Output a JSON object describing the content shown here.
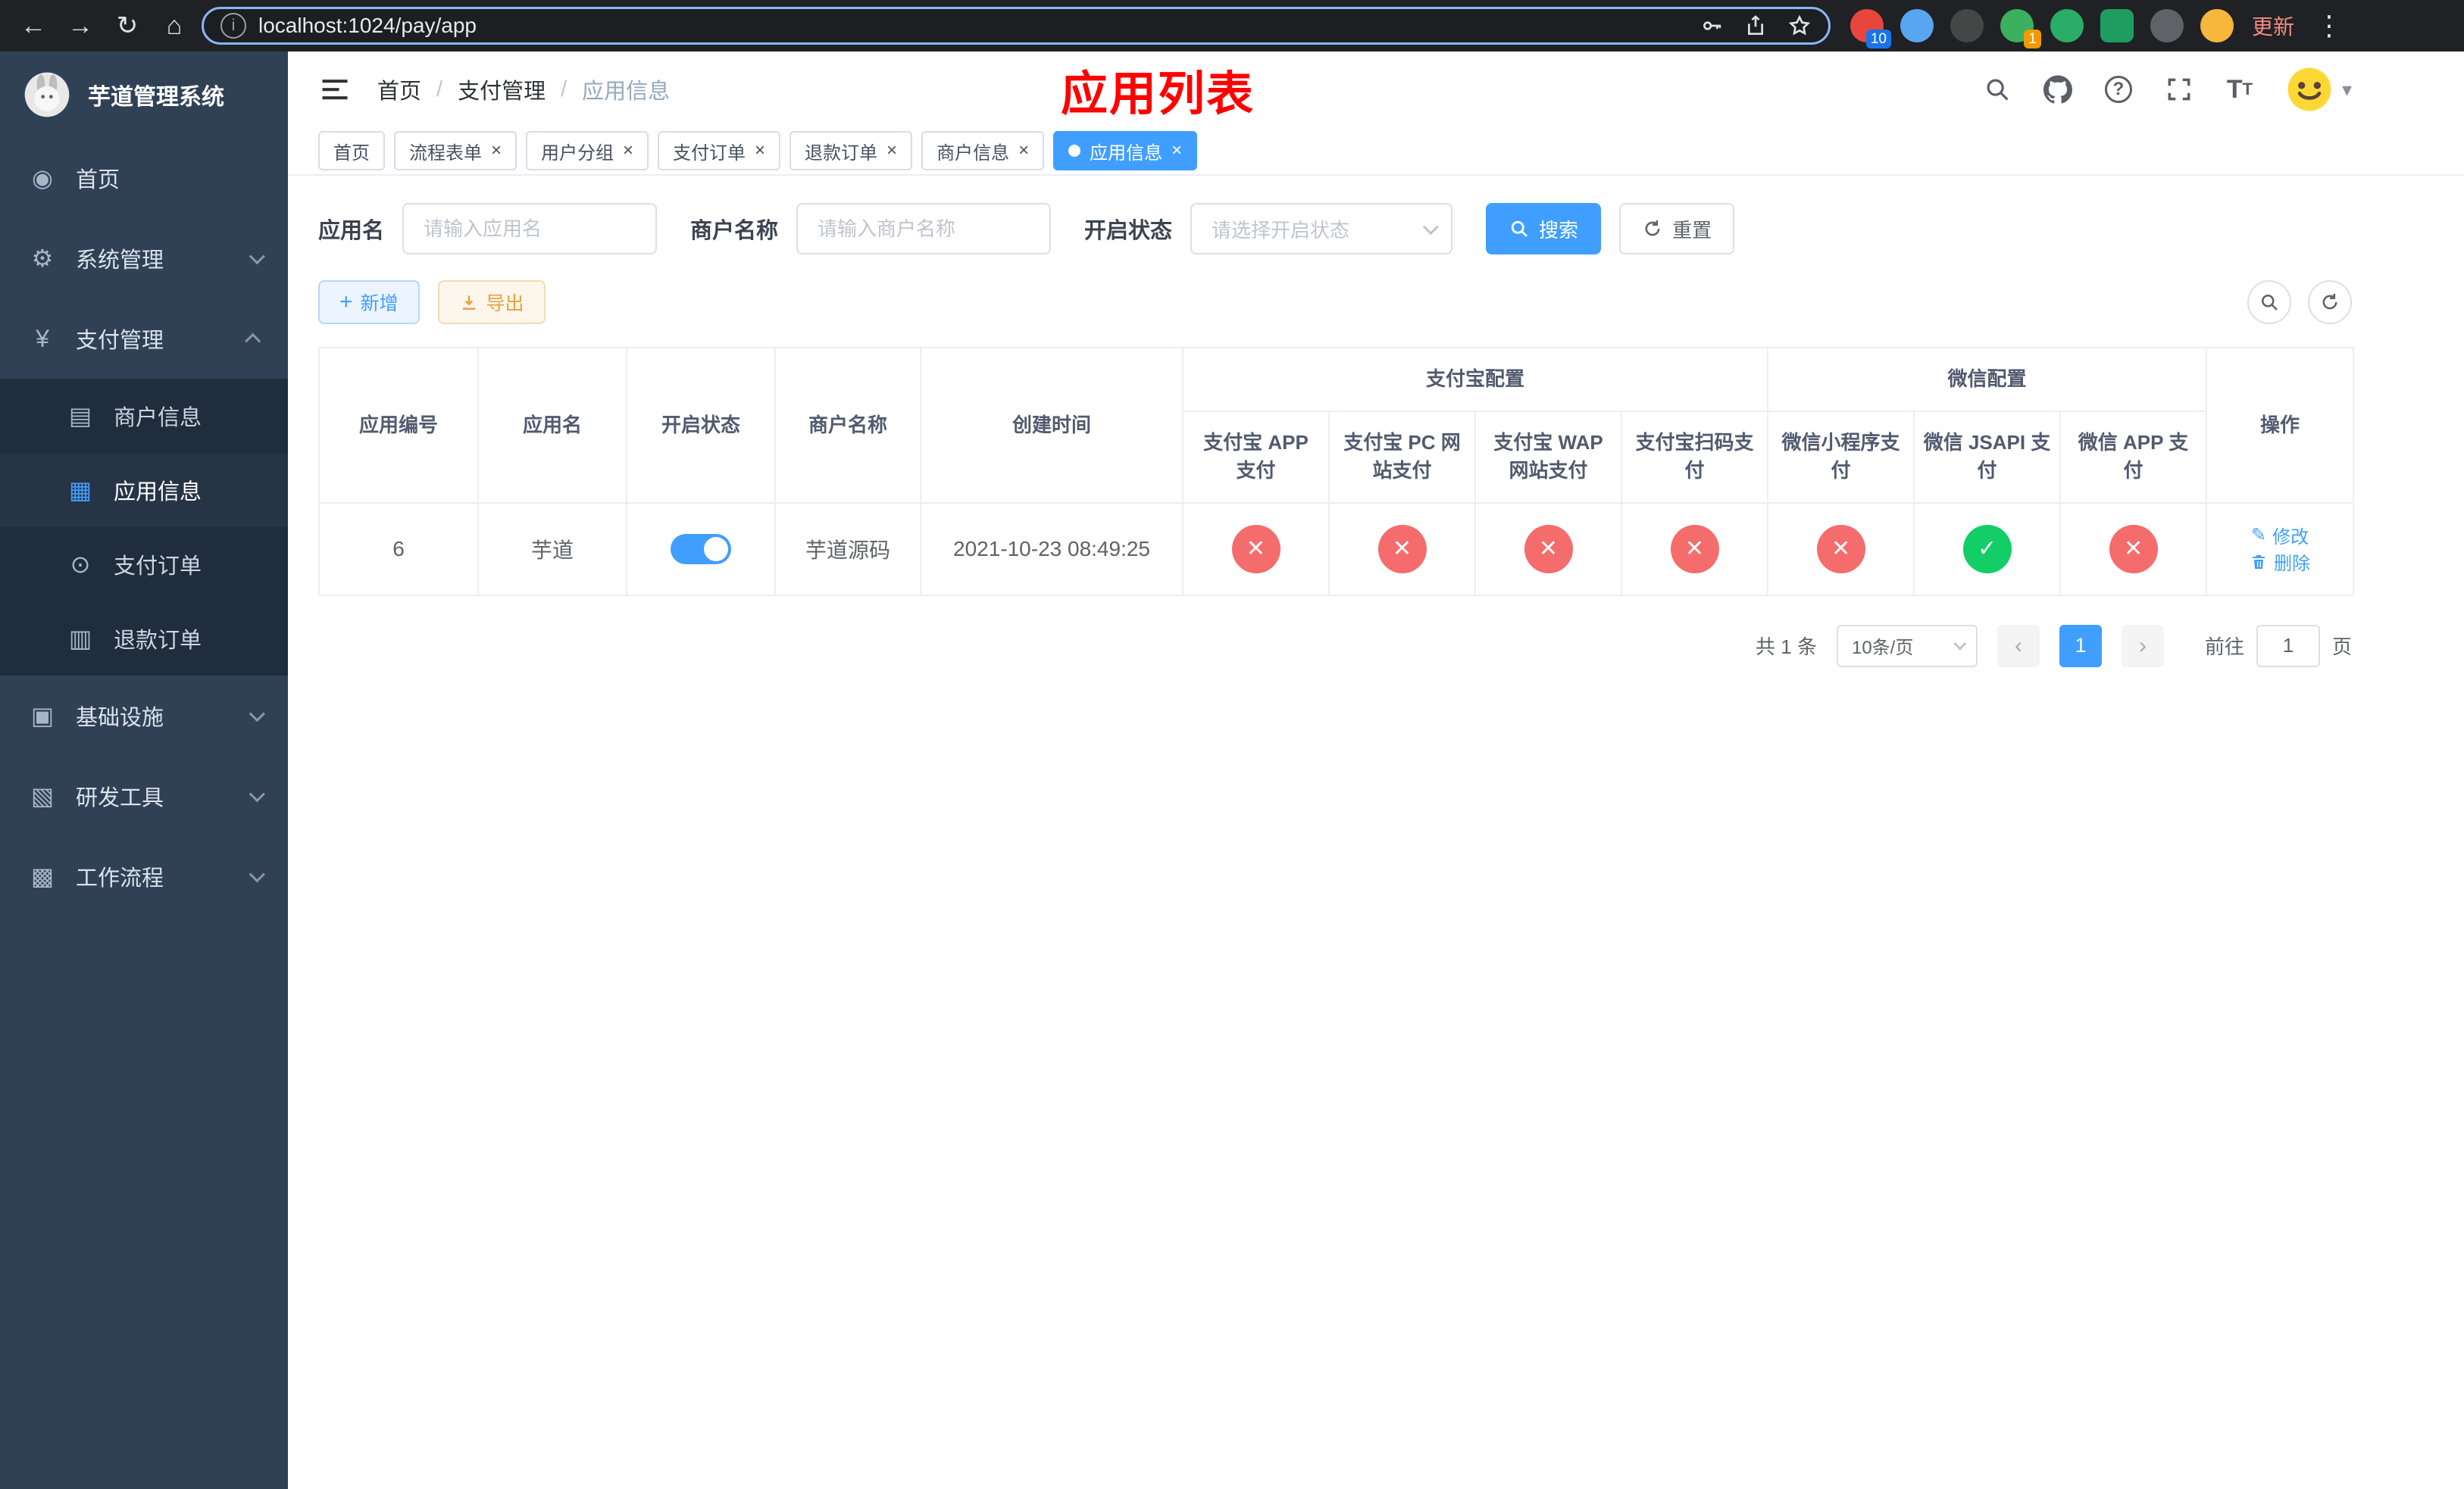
{
  "colors": {
    "primary": "#409eff",
    "success": "#13ce66",
    "danger": "#f56c6c",
    "overlay_title_red": "#fe0000",
    "sidebar_bg": "#304156"
  },
  "icons": {
    "back": "←",
    "forward": "→",
    "reload": "↻",
    "home": "⌂",
    "info": "i",
    "dots": "⋮",
    "dashboard": "◉",
    "gear": "⚙",
    "yen": "¥",
    "merchant": "▤",
    "app": "▦",
    "pay_order": "⊙",
    "refund_order": "▥",
    "infra": "▣",
    "tools": "▧",
    "workflow": "▩",
    "question": "?",
    "fontsize_large": "T",
    "fontsize_small": "T",
    "caret": "▾",
    "edit": "✎",
    "plus": "+",
    "check": "✓",
    "cross": "✕",
    "prev": "‹",
    "next": "›"
  },
  "browser": {
    "url": "localhost:1024/pay/app",
    "update_label": "更新",
    "ext_badge_1": "10",
    "ext_badge_2": "1"
  },
  "sidebar": {
    "logo_title": "芋道管理系统",
    "items": [
      {
        "label": "首页"
      },
      {
        "label": "系统管理"
      },
      {
        "label": "支付管理",
        "children": [
          {
            "label": "商户信息"
          },
          {
            "label": "应用信息"
          },
          {
            "label": "支付订单"
          },
          {
            "label": "退款订单"
          }
        ]
      },
      {
        "label": "基础设施"
      },
      {
        "label": "研发工具"
      },
      {
        "label": "工作流程"
      }
    ]
  },
  "header": {
    "breadcrumb": [
      "首页",
      "支付管理",
      "应用信息"
    ],
    "overlay_title": "应用列表"
  },
  "tabs": {
    "items": [
      {
        "label": "首页"
      },
      {
        "label": "流程表单"
      },
      {
        "label": "用户分组"
      },
      {
        "label": "支付订单"
      },
      {
        "label": "退款订单"
      },
      {
        "label": "商户信息"
      },
      {
        "label": "应用信息"
      }
    ]
  },
  "filters": {
    "app_name_label": "应用名",
    "app_name_placeholder": "请输入应用名",
    "merchant_label": "商户名称",
    "merchant_placeholder": "请输入商户名称",
    "status_label": "开启状态",
    "status_placeholder": "请选择开启状态",
    "search_label": "搜索",
    "reset_label": "重置"
  },
  "toolbar": {
    "add_label": "新增",
    "export_label": "导出"
  },
  "table": {
    "columns_left": [
      "应用编号",
      "应用名",
      "开启状态",
      "商户名称",
      "创建时间"
    ],
    "alipay_group": {
      "label": "支付宝配置",
      "columns": [
        "支付宝 APP 支付",
        "支付宝 PC 网站支付",
        "支付宝 WAP 网站支付",
        "支付宝扫码支付"
      ]
    },
    "wechat_group": {
      "label": "微信配置",
      "columns": [
        "微信小程序支付",
        "微信 JSAPI 支付",
        "微信 APP 支付"
      ]
    },
    "actions_column": "操作",
    "actions": {
      "edit_label": "修改",
      "delete_label": "删除"
    },
    "rows": [
      {
        "app_id": "6",
        "app_name": "芋道",
        "enabled": true,
        "merchant_name": "芋道源码",
        "create_time": "2021-10-23 08:49:25",
        "alipay_app": false,
        "alipay_pc": false,
        "alipay_wap": false,
        "alipay_qr": false,
        "wechat_mini": false,
        "wechat_jsapi": true,
        "wechat_app": false
      }
    ]
  },
  "pagination": {
    "total": "共 1 条",
    "page_size": "10条/页",
    "page": "1",
    "goto_label": "前往",
    "goto_value": "1",
    "goto_unit": "页"
  }
}
